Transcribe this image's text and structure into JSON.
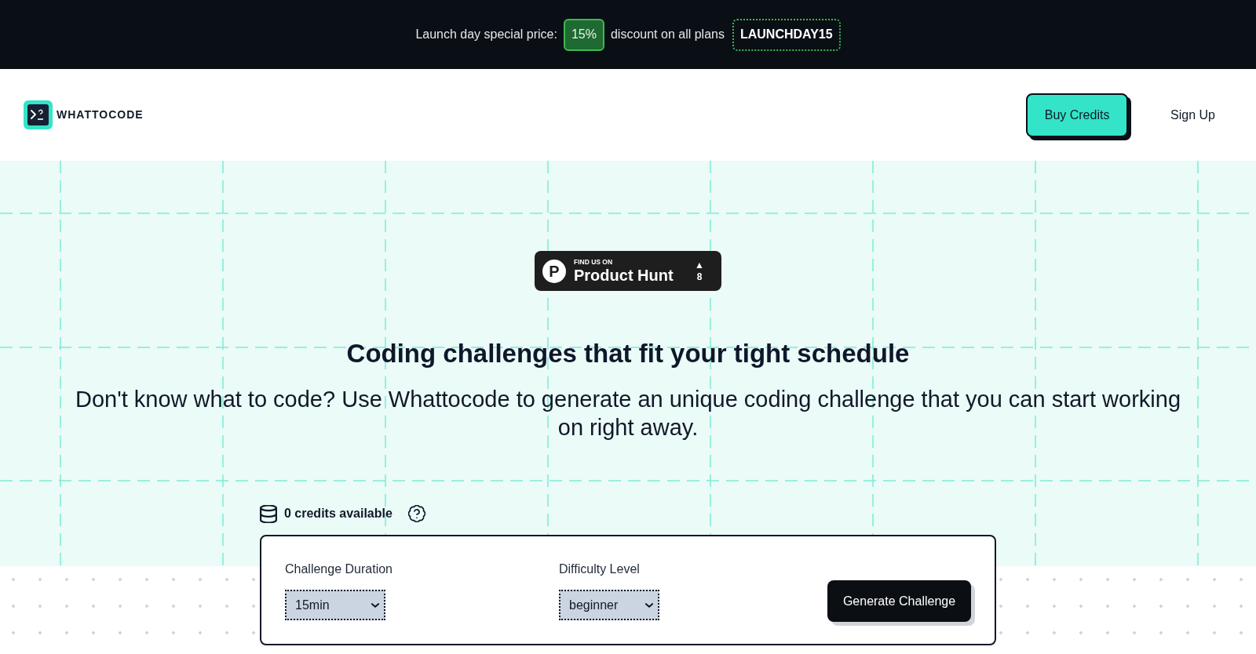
{
  "announcement": {
    "prefix": "Launch day special price:",
    "discount": "15%",
    "suffix": "discount on all plans",
    "promo_code": "LAUNCHDAY15"
  },
  "header": {
    "logo_text": "WHATTOCODE",
    "nav": [
      {
        "label": "Buy Credits",
        "kind": "button"
      },
      {
        "label": "Sign Up",
        "kind": "link"
      }
    ]
  },
  "product_hunt_badge": {
    "logo_letter": "P",
    "caption": "FIND US ON",
    "name": "Product Hunt",
    "upvote_icon": "▲",
    "count": "8"
  },
  "hero": {
    "title": "Coding challenges that fit your tight schedule",
    "subtitle": "Don't know what to code? Use Whattocode to generate an unique coding challenge that you can start working on right away."
  },
  "credits": {
    "text": "0 credits available"
  },
  "challenge_form": {
    "fields": [
      {
        "label": "Challenge Duration",
        "value": "15min"
      },
      {
        "label": "Difficulty Level",
        "value": "beginner"
      }
    ],
    "submit_button": "Generate Challenge"
  }
}
